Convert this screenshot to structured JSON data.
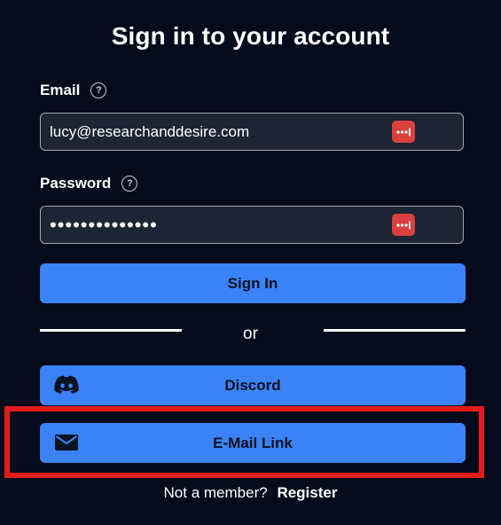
{
  "title": "Sign in to your account",
  "email": {
    "label": "Email",
    "value": "lucy@researchanddesire.com"
  },
  "password": {
    "label": "Password",
    "value": "••••••••••••••"
  },
  "buttons": {
    "sign_in": "Sign In",
    "discord": "Discord",
    "email_link": "E-Mail Link"
  },
  "divider_text": "or",
  "footer": {
    "prompt": "Not a member?",
    "register": "Register"
  },
  "icons": {
    "help": "question-circle-icon",
    "password_manager": "password-manager-icon",
    "discord": "discord-icon",
    "email": "envelope-icon"
  },
  "colors": {
    "background": "#050b1b",
    "input_background": "#1d2433",
    "button": "#3b82f6",
    "highlight": "#e21c1c",
    "password_manager": "#d9403e"
  }
}
